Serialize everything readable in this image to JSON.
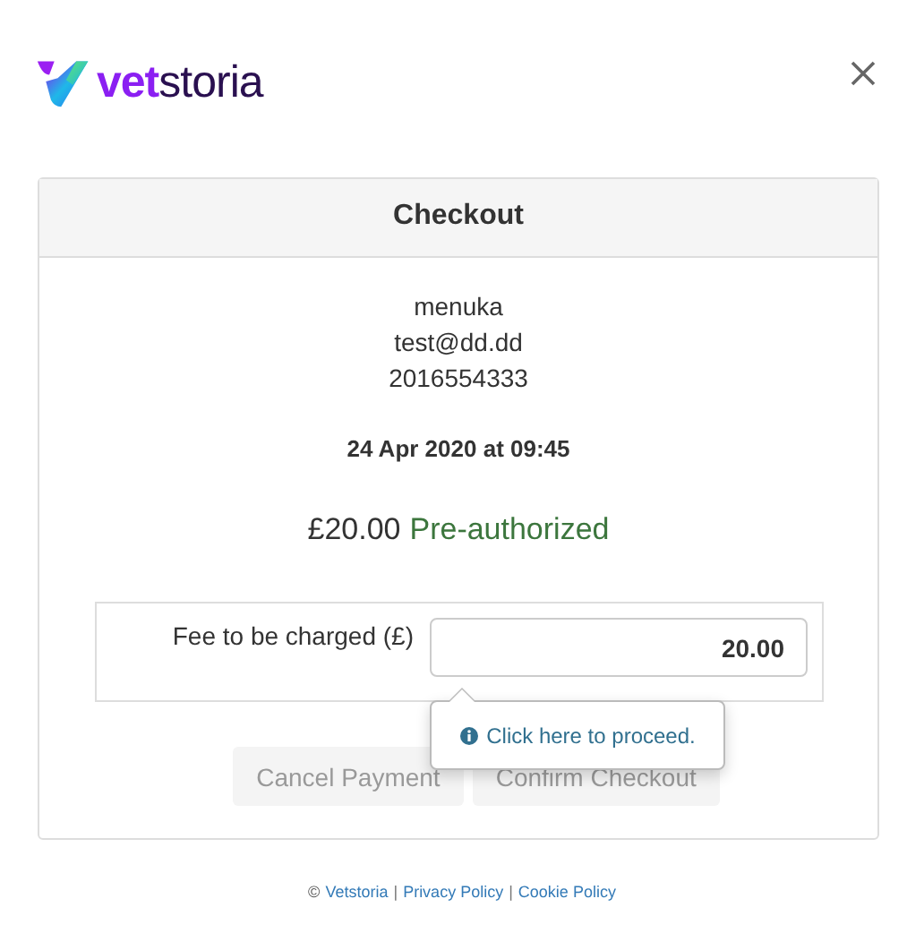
{
  "logo": {
    "prefix": "vet",
    "suffix": "storia"
  },
  "card": {
    "title": "Checkout",
    "customer": [
      "menuka",
      "test@dd.dd",
      "2016554333"
    ],
    "appointment": "24 Apr 2020 at 09:45",
    "amount": "£20.00",
    "status": "Pre-authorized",
    "fee": {
      "label": "Fee to be charged (£)",
      "value": "20.00"
    },
    "popover": {
      "text": "Click here to proceed."
    },
    "buttons": [
      {
        "label": "Cancel Payment",
        "disabled": true
      },
      {
        "label": "Confirm Checkout",
        "disabled": true
      }
    ]
  },
  "footer": {
    "copyright": "©",
    "links": [
      "Vetstoria",
      "Privacy Policy",
      "Cookie Policy"
    ],
    "separator": "|"
  }
}
